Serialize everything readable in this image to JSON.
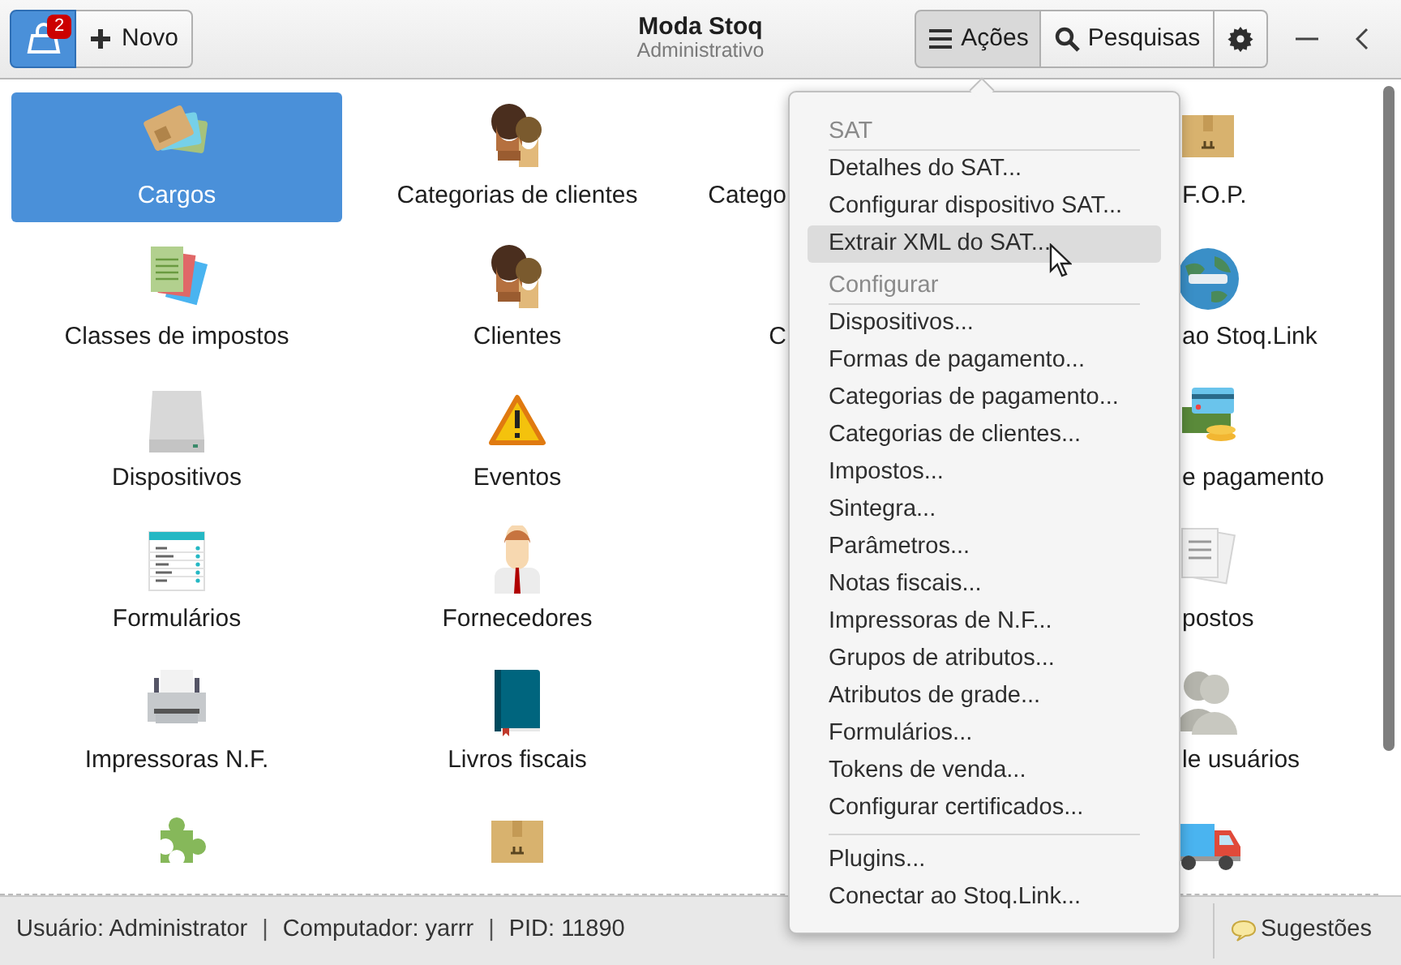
{
  "header": {
    "notification_count": "2",
    "new_button": "Novo",
    "title": "Moda Stoq",
    "subtitle": "Administrativo",
    "actions_button": {
      "label": "Ações",
      "selected": true
    },
    "search_button": "Pesquisas"
  },
  "launcher": {
    "columns": [
      {
        "kind": "full",
        "items": [
          {
            "label": "Cargos",
            "selected": true
          },
          {
            "label": "Classes de impostos",
            "selected": false
          },
          {
            "label": "Dispositivos",
            "selected": false
          },
          {
            "label": "Formulários",
            "selected": false
          },
          {
            "label": "Impressoras N.F.",
            "selected": false
          },
          {
            "selected": false
          }
        ]
      },
      {
        "kind": "full",
        "items": [
          {
            "label": "Categorias de clientes",
            "selected": false
          },
          {
            "label": "Clientes",
            "selected": false
          },
          {
            "label": "Eventos",
            "selected": false
          },
          {
            "label": "Fornecedores",
            "selected": false
          },
          {
            "label": "Livros fiscais",
            "selected": false
          },
          {
            "selected": false
          }
        ]
      },
      {
        "kind": "cut_right",
        "items": [
          {
            "label": "Catego",
            "selected": false
          },
          {
            "label": "C",
            "selected": false
          }
        ]
      },
      {
        "kind": "cut_left",
        "items": [
          {
            "label": "F.O.P.",
            "selected": false
          },
          {
            "label": "ao Stoq.Link",
            "selected": false
          },
          {
            "label": "e pagamento",
            "selected": false
          },
          {
            "label": "postos",
            "selected": false
          },
          {
            "label": "le usuários",
            "selected": false
          },
          {
            "selected": false
          }
        ]
      }
    ]
  },
  "actions_menu": {
    "sections": [
      {
        "header": "SAT",
        "items": [
          {
            "label": "Detalhes do SAT...",
            "hovered": false
          },
          {
            "label": "Configurar dispositivo SAT...",
            "hovered": false
          },
          {
            "label": "Extrair XML do SAT...",
            "hovered": true
          }
        ]
      },
      {
        "header": "Configurar",
        "items": [
          {
            "label": "Dispositivos...",
            "hovered": false
          },
          {
            "label": "Formas de pagamento...",
            "hovered": false
          },
          {
            "label": "Categorias de pagamento...",
            "hovered": false
          },
          {
            "label": "Categorias de clientes...",
            "hovered": false
          },
          {
            "label": "Impostos...",
            "hovered": false
          },
          {
            "label": "Sintegra...",
            "hovered": false
          },
          {
            "label": "Parâmetros...",
            "hovered": false
          },
          {
            "label": "Notas fiscais...",
            "hovered": false
          },
          {
            "label": "Impressoras de N.F...",
            "hovered": false
          },
          {
            "label": "Grupos de atributos...",
            "hovered": false
          },
          {
            "label": "Atributos de grade...",
            "hovered": false
          },
          {
            "label": "Formulários...",
            "hovered": false
          },
          {
            "label": "Tokens de venda...",
            "hovered": false
          },
          {
            "label": "Configurar certificados...",
            "hovered": false
          }
        ]
      },
      {
        "items": [
          {
            "label": "Plugins...",
            "hovered": false
          },
          {
            "label": "Conectar ao Stoq.Link...",
            "hovered": false
          }
        ]
      }
    ]
  },
  "status_bar": {
    "separator": "|",
    "fields": [
      "Usuário: Administrator",
      "Computador: yarrr",
      "PID: 11890"
    ],
    "feedback_button": "Sugestões"
  }
}
